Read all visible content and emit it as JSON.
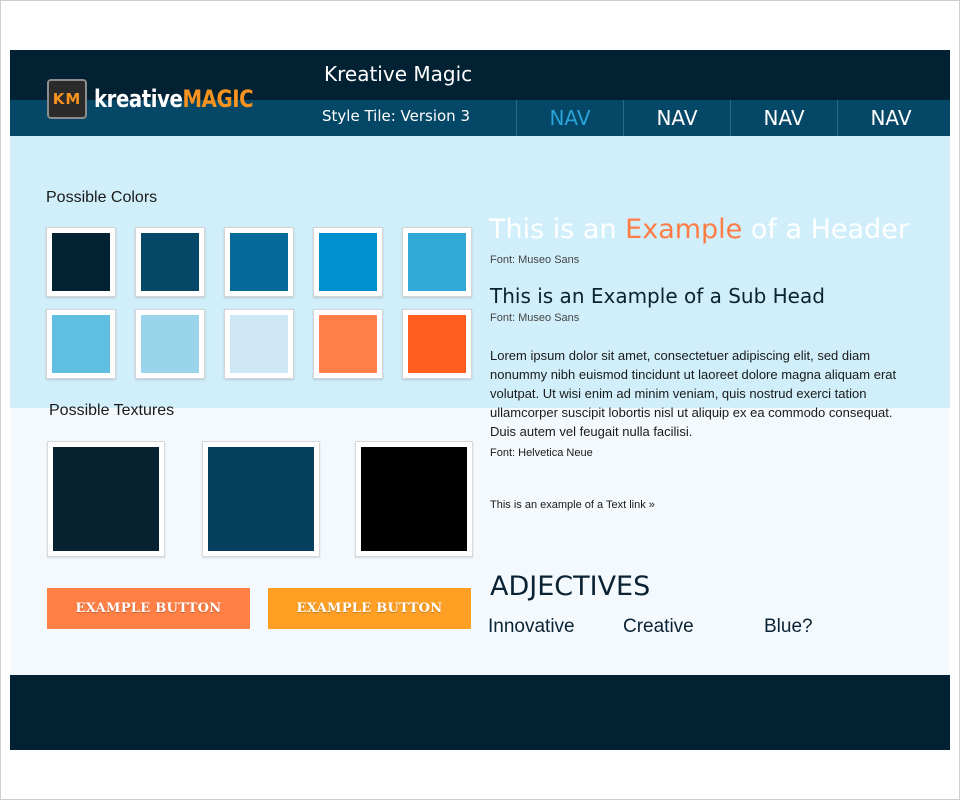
{
  "brand": {
    "logo_mark": "KM",
    "logo_word_1": "kreative",
    "logo_word_2": "MAGIC"
  },
  "header": {
    "title": "Kreative Magic",
    "subtitle": "Style Tile: Version 3",
    "nav": [
      {
        "label": "NAV",
        "active": true
      },
      {
        "label": "NAV",
        "active": false
      },
      {
        "label": "NAV",
        "active": false
      },
      {
        "label": "NAV",
        "active": false
      }
    ]
  },
  "colors_section": {
    "label": "Possible Colors",
    "swatches": [
      "#022133",
      "#044766",
      "#046a9a",
      "#0090cf",
      "#32a8d6",
      "#60bfe0",
      "#9ad4eb",
      "#cde8f4",
      "#ff7f4a",
      "#ff5e1e"
    ]
  },
  "textures_section": {
    "label": "Possible Textures",
    "textures": [
      "#06212f",
      "#07405e",
      "#000000"
    ]
  },
  "buttons": {
    "primary": "EXAMPLE BUTTON",
    "secondary": "EXAMPLE BUTTON",
    "primary_color": "#ff7f45",
    "secondary_color": "#ffa025"
  },
  "typography": {
    "header_pre": "This is an ",
    "header_accent": "Example",
    "header_post": " of a Header",
    "header_font": "Font: Museo Sans",
    "subhead": "This is an Example of a Sub Head",
    "subhead_font": "Font: Museo Sans",
    "body": "Lorem ipsum dolor sit amet, consectetuer adipiscing elit, sed diam nonummy nibh euismod tincidunt ut laoreet dolore magna aliquam erat volutpat. Ut wisi enim ad minim veniam, quis nostrud exerci tation ullamcorper suscipit lobortis nisl ut aliquip ex ea commodo consequat. Duis autem vel feugait nulla facilisi.",
    "body_font": "Font: Helvetica Neue",
    "text_link": "This is an example of a Text link »"
  },
  "adjectives": {
    "title": "ADJECTIVES",
    "items": [
      "Innovative",
      "Creative",
      "Blue?"
    ]
  }
}
